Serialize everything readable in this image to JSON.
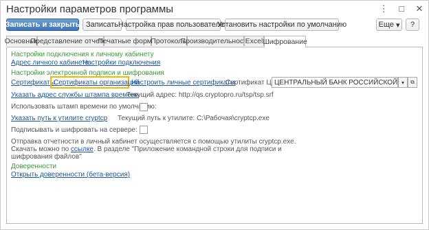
{
  "window": {
    "title": "Настройки параметров программы",
    "controls": [
      "⋮",
      "□",
      "✕"
    ]
  },
  "toolbar": {
    "save_close": "Записать и закрыть",
    "save": "Записать",
    "user_rights": "Настройка прав пользователей",
    "defaults": "Установить настройки по умолчанию",
    "more": "Еще",
    "more_arrow": "▾",
    "help": "?"
  },
  "tabs": [
    "Основные",
    "Представление отчетов",
    "Печатные формы",
    "Протоколы",
    "Производительность",
    "Excel",
    "Шифрование"
  ],
  "panel": {
    "section1_title": "Настройки подключения к личному кабинету",
    "link_cabinet_address": "Адрес личного кабинета",
    "link_connection_settings": "Настройки подключения",
    "section2_title": "Настройки электронной подписи и шифрования",
    "link_certificates": "Сертификаты",
    "link_org_certificates": "Сертификаты организаций",
    "link_personal_certificates": "Настроить личные сертификаты",
    "cbr_label": "Сертификат ЦБ:",
    "cbr_value": "ЦЕНТРАЛЬНЫЙ БАНК РОССИЙСКОЙ ФЕДЕР",
    "link_tsp_address": "Указать адрес службы штампа времени",
    "tsp_current": "Текущий адрес: http://qs.cryptopro.ru/tsp/tsp.srf",
    "timestamp_default_label": "Использовать штамп времени по умолчанию:",
    "link_cryptcp_path": "Указать путь к утилите cryptcp",
    "cryptcp_current": "Текущий путь к утилите: C:\\Рабочая\\cryptcp.exe",
    "server_sign_label": "Подписывать и шифровать на сервере:",
    "info_line1": "Отправка отчетности в личный кабинет осуществляется с помощью утилиты cryptcp.exe.",
    "info_line2_pre": "Скачать можно по ",
    "info_link": "ссылке",
    "info_line2_post": ". В разделе \"Приложение командной строки для подписи и",
    "info_line3": "шифрования файлов\"",
    "section3_title": "Доверенности",
    "link_open_poa": "Открыть доверенности (бета-версия)"
  }
}
